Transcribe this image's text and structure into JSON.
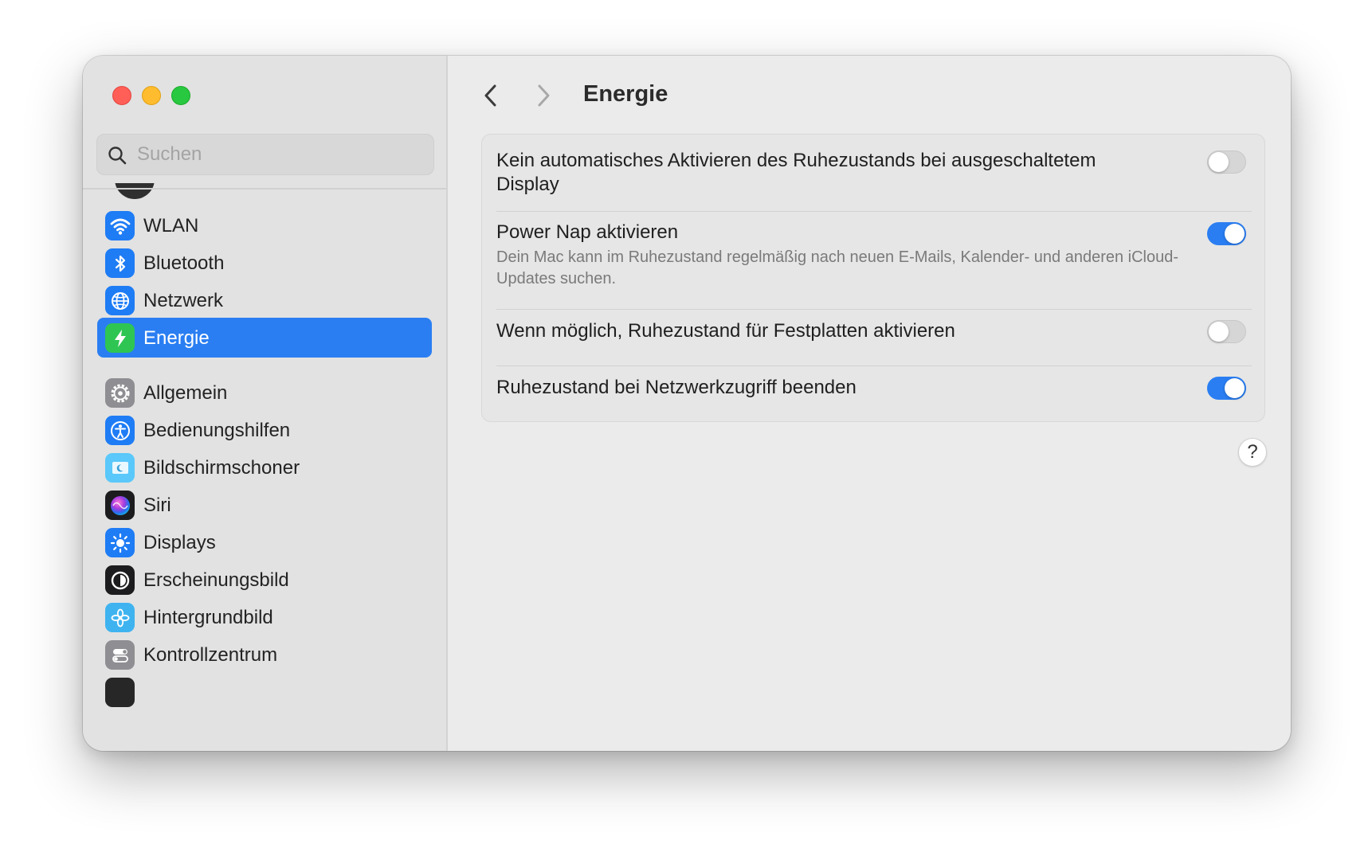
{
  "window": {
    "title": "Energie"
  },
  "search": {
    "placeholder": "Suchen",
    "icon": "search-icon"
  },
  "sidebar": {
    "items": [
      {
        "id": "wlan",
        "label": "WLAN",
        "icon": "wifi-icon",
        "color": "#1e7cf5",
        "active": false
      },
      {
        "id": "bluetooth",
        "label": "Bluetooth",
        "icon": "bluetooth-icon",
        "color": "#1e7cf5",
        "active": false
      },
      {
        "id": "netzwerk",
        "label": "Netzwerk",
        "icon": "globe-icon",
        "color": "#1e7cf5",
        "active": false
      },
      {
        "id": "energie",
        "label": "Energie",
        "icon": "lightning-icon",
        "color": "#2fc553",
        "active": true
      },
      {
        "id": "allgemein",
        "label": "Allgemein",
        "icon": "gear-icon",
        "color": "#8e8e93",
        "active": false
      },
      {
        "id": "bedienungshilfen",
        "label": "Bedienungshilfen",
        "icon": "accessibility-icon",
        "color": "#1e7cf5",
        "active": false
      },
      {
        "id": "bildschirmschoner",
        "label": "Bildschirmschoner",
        "icon": "screensaver-icon",
        "color": "#5ac8fa",
        "active": false
      },
      {
        "id": "siri",
        "label": "Siri",
        "icon": "siri-icon",
        "color": "#7a2bd6",
        "active": false
      },
      {
        "id": "displays",
        "label": "Displays",
        "icon": "sun-icon",
        "color": "#1e7cf5",
        "active": false
      },
      {
        "id": "erscheinungsbild",
        "label": "Erscheinungsbild",
        "icon": "appearance-icon",
        "color": "#1c1c1e",
        "active": false
      },
      {
        "id": "hintergrundbild",
        "label": "Hintergrundbild",
        "icon": "flower-icon",
        "color": "#3fb3f0",
        "active": false
      },
      {
        "id": "kontrollzentrum",
        "label": "Kontrollzentrum",
        "icon": "switches-icon",
        "color": "#8e8e93",
        "active": false
      }
    ]
  },
  "nav": {
    "back_icon": "chevron-left-icon",
    "forward_icon": "chevron-right-icon"
  },
  "settings": [
    {
      "label": "Kein automatisches Aktivieren des Ruhezustands bei ausgeschaltetem Display",
      "description": "",
      "enabled": false
    },
    {
      "label": "Power Nap aktivieren",
      "description": "Dein Mac kann im Ruhezustand regelmäßig nach neuen E-Mails, Kalender- und anderen iCloud-Updates suchen.",
      "enabled": true
    },
    {
      "label": "Wenn möglich, Ruhezustand für Festplatten aktivieren",
      "description": "",
      "enabled": false
    },
    {
      "label": "Ruhezustand bei Netzwerkzugriff beenden",
      "description": "",
      "enabled": true
    }
  ],
  "help": {
    "label": "?"
  },
  "colors": {
    "accent": "#2a7ef2",
    "close": "#ff5f57",
    "minimize": "#febc2e",
    "zoom": "#28c840"
  }
}
